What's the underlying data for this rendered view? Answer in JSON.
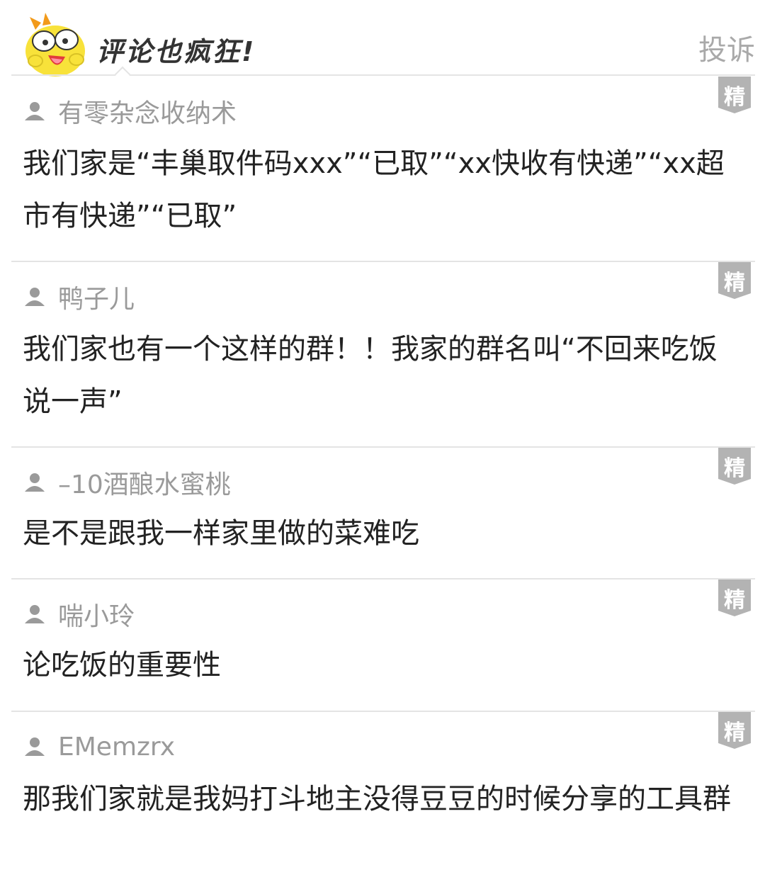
{
  "header": {
    "title": "评论也疯狂!",
    "report_label": "投诉"
  },
  "comments": [
    {
      "user": "有零杂念收纳术",
      "text": "我们家是“丰巢取件码xxx”“已取”“xx快收有快递”“xx超市有快递”“已取”",
      "badge": "精"
    },
    {
      "user": "鸭子儿",
      "text": "我们家也有一个这样的群！！我家的群名叫“不回来吃饭说一声”",
      "badge": "精"
    },
    {
      "user": "–10酒酿水蜜桃",
      "text": "是不是跟我一样家里做的菜难吃",
      "badge": "精"
    },
    {
      "user": "喘小玲",
      "text": "论吃饭的重要性",
      "badge": "精"
    },
    {
      "user": "EMemzrx",
      "text": "那我们家就是我妈打斗地主没得豆豆的时候分享的工具群",
      "badge": "精"
    }
  ],
  "colors": {
    "divider": "#e4e4e4",
    "username": "#9a9a9a",
    "comment_text": "#222222",
    "badge_bg": "#b3b3b3",
    "mascot_yellow": "#f8e23a"
  },
  "icons": {
    "mascot": "yellow-cartoon-mascot",
    "user": "user-silhouette-icon",
    "badge": "featured-ribbon-badge"
  }
}
